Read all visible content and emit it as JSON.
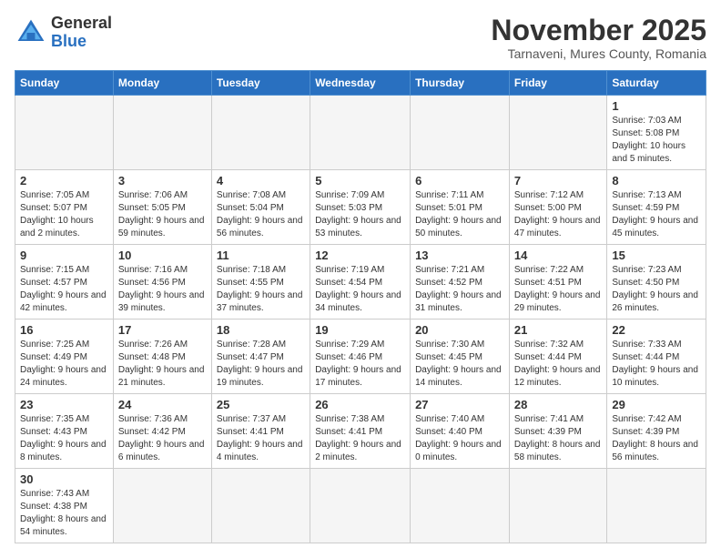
{
  "header": {
    "logo_general": "General",
    "logo_blue": "Blue",
    "month": "November 2025",
    "location": "Tarnaveni, Mures County, Romania"
  },
  "weekdays": [
    "Sunday",
    "Monday",
    "Tuesday",
    "Wednesday",
    "Thursday",
    "Friday",
    "Saturday"
  ],
  "weeks": [
    [
      {
        "day": "",
        "info": ""
      },
      {
        "day": "",
        "info": ""
      },
      {
        "day": "",
        "info": ""
      },
      {
        "day": "",
        "info": ""
      },
      {
        "day": "",
        "info": ""
      },
      {
        "day": "",
        "info": ""
      },
      {
        "day": "1",
        "info": "Sunrise: 7:03 AM\nSunset: 5:08 PM\nDaylight: 10 hours and 5 minutes."
      }
    ],
    [
      {
        "day": "2",
        "info": "Sunrise: 7:05 AM\nSunset: 5:07 PM\nDaylight: 10 hours and 2 minutes."
      },
      {
        "day": "3",
        "info": "Sunrise: 7:06 AM\nSunset: 5:05 PM\nDaylight: 9 hours and 59 minutes."
      },
      {
        "day": "4",
        "info": "Sunrise: 7:08 AM\nSunset: 5:04 PM\nDaylight: 9 hours and 56 minutes."
      },
      {
        "day": "5",
        "info": "Sunrise: 7:09 AM\nSunset: 5:03 PM\nDaylight: 9 hours and 53 minutes."
      },
      {
        "day": "6",
        "info": "Sunrise: 7:11 AM\nSunset: 5:01 PM\nDaylight: 9 hours and 50 minutes."
      },
      {
        "day": "7",
        "info": "Sunrise: 7:12 AM\nSunset: 5:00 PM\nDaylight: 9 hours and 47 minutes."
      },
      {
        "day": "8",
        "info": "Sunrise: 7:13 AM\nSunset: 4:59 PM\nDaylight: 9 hours and 45 minutes."
      }
    ],
    [
      {
        "day": "9",
        "info": "Sunrise: 7:15 AM\nSunset: 4:57 PM\nDaylight: 9 hours and 42 minutes."
      },
      {
        "day": "10",
        "info": "Sunrise: 7:16 AM\nSunset: 4:56 PM\nDaylight: 9 hours and 39 minutes."
      },
      {
        "day": "11",
        "info": "Sunrise: 7:18 AM\nSunset: 4:55 PM\nDaylight: 9 hours and 37 minutes."
      },
      {
        "day": "12",
        "info": "Sunrise: 7:19 AM\nSunset: 4:54 PM\nDaylight: 9 hours and 34 minutes."
      },
      {
        "day": "13",
        "info": "Sunrise: 7:21 AM\nSunset: 4:52 PM\nDaylight: 9 hours and 31 minutes."
      },
      {
        "day": "14",
        "info": "Sunrise: 7:22 AM\nSunset: 4:51 PM\nDaylight: 9 hours and 29 minutes."
      },
      {
        "day": "15",
        "info": "Sunrise: 7:23 AM\nSunset: 4:50 PM\nDaylight: 9 hours and 26 minutes."
      }
    ],
    [
      {
        "day": "16",
        "info": "Sunrise: 7:25 AM\nSunset: 4:49 PM\nDaylight: 9 hours and 24 minutes."
      },
      {
        "day": "17",
        "info": "Sunrise: 7:26 AM\nSunset: 4:48 PM\nDaylight: 9 hours and 21 minutes."
      },
      {
        "day": "18",
        "info": "Sunrise: 7:28 AM\nSunset: 4:47 PM\nDaylight: 9 hours and 19 minutes."
      },
      {
        "day": "19",
        "info": "Sunrise: 7:29 AM\nSunset: 4:46 PM\nDaylight: 9 hours and 17 minutes."
      },
      {
        "day": "20",
        "info": "Sunrise: 7:30 AM\nSunset: 4:45 PM\nDaylight: 9 hours and 14 minutes."
      },
      {
        "day": "21",
        "info": "Sunrise: 7:32 AM\nSunset: 4:44 PM\nDaylight: 9 hours and 12 minutes."
      },
      {
        "day": "22",
        "info": "Sunrise: 7:33 AM\nSunset: 4:44 PM\nDaylight: 9 hours and 10 minutes."
      }
    ],
    [
      {
        "day": "23",
        "info": "Sunrise: 7:35 AM\nSunset: 4:43 PM\nDaylight: 9 hours and 8 minutes."
      },
      {
        "day": "24",
        "info": "Sunrise: 7:36 AM\nSunset: 4:42 PM\nDaylight: 9 hours and 6 minutes."
      },
      {
        "day": "25",
        "info": "Sunrise: 7:37 AM\nSunset: 4:41 PM\nDaylight: 9 hours and 4 minutes."
      },
      {
        "day": "26",
        "info": "Sunrise: 7:38 AM\nSunset: 4:41 PM\nDaylight: 9 hours and 2 minutes."
      },
      {
        "day": "27",
        "info": "Sunrise: 7:40 AM\nSunset: 4:40 PM\nDaylight: 9 hours and 0 minutes."
      },
      {
        "day": "28",
        "info": "Sunrise: 7:41 AM\nSunset: 4:39 PM\nDaylight: 8 hours and 58 minutes."
      },
      {
        "day": "29",
        "info": "Sunrise: 7:42 AM\nSunset: 4:39 PM\nDaylight: 8 hours and 56 minutes."
      }
    ],
    [
      {
        "day": "30",
        "info": "Sunrise: 7:43 AM\nSunset: 4:38 PM\nDaylight: 8 hours and 54 minutes."
      },
      {
        "day": "",
        "info": ""
      },
      {
        "day": "",
        "info": ""
      },
      {
        "day": "",
        "info": ""
      },
      {
        "day": "",
        "info": ""
      },
      {
        "day": "",
        "info": ""
      },
      {
        "day": "",
        "info": ""
      }
    ]
  ]
}
